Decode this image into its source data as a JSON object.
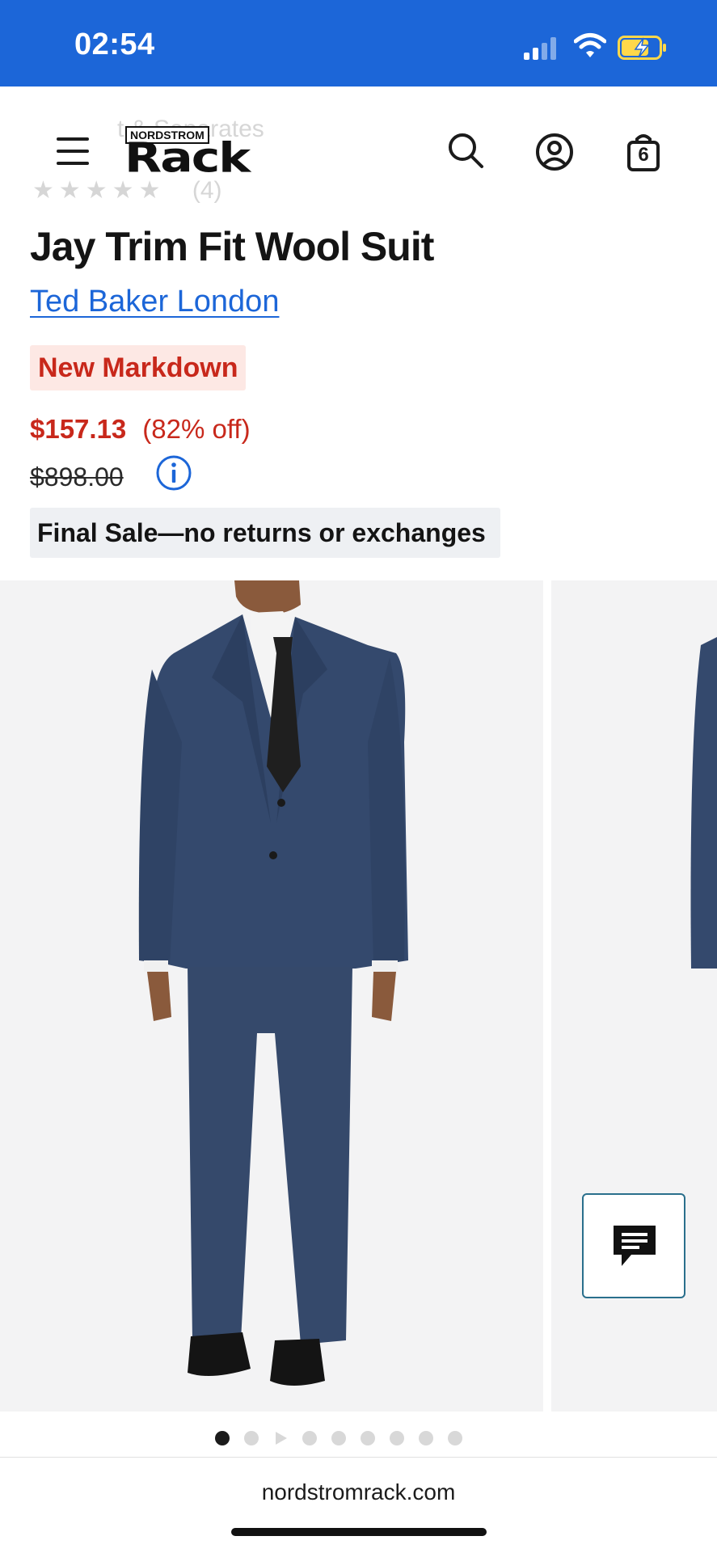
{
  "status_bar": {
    "time": "02:54"
  },
  "header": {
    "logo_small": "NORDSTROM",
    "logo_big": "Rack",
    "bag_count": "6",
    "behind_text_1": "t & Separates",
    "behind_text_2": "(4)"
  },
  "product": {
    "title": "Jay Trim Fit Wool Suit",
    "brand": "Ted Baker London",
    "badge": "New Markdown",
    "sale_price": "$157.13",
    "discount": "(82% off)",
    "original_price": "$898.00",
    "final_sale": "Final Sale—no returns or exchanges"
  },
  "gallery": {
    "image_count": 9,
    "active_index": 0
  },
  "browser": {
    "url": "nordstromrack.com"
  },
  "colors": {
    "brand_blue": "#1c66d8",
    "sale_red": "#c8281b",
    "badge_bg": "#fde8e4"
  }
}
